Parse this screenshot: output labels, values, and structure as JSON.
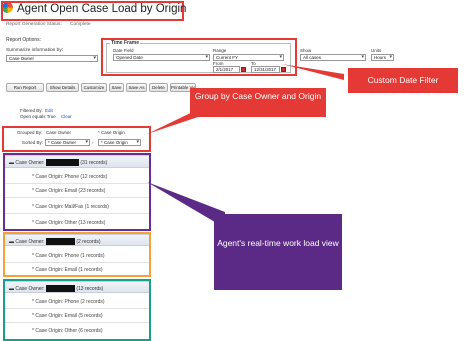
{
  "header": {
    "title": "Agent Open Case Load by Origin",
    "status_label": "Report Generation Status:",
    "status_value": "Complete"
  },
  "options": {
    "heading": "Report Options:",
    "summarize_label": "Summarize information by:",
    "summarize_value": "Case Owner",
    "time_frame_label": "Time Frame",
    "date_field_label": "Date Field",
    "date_field_value": "Opened Date",
    "range_label": "Range",
    "range_value": "Current FY",
    "from_label": "From",
    "from_value": "2/1/2017",
    "to_label": "To",
    "to_value": "12/31/2017",
    "show_label": "Show",
    "show_value": "All cases",
    "units_label": "Units",
    "units_value": "Hours"
  },
  "toolbar": {
    "run_report": "Run Report",
    "hide_details": "Show Details",
    "customize": "Customize",
    "save": "Save",
    "save_as": "Save As",
    "delete": "Delete",
    "printable": "Printable View"
  },
  "filters": {
    "filtered_by": "Filtered By:",
    "edit": "Edit",
    "open_equals": "Open equals True",
    "clear": "Clear"
  },
  "grouping": {
    "grouped_by_label": "Grouped By:",
    "grouped_by_value": "Case Owner",
    "then_label": "* Case Origin",
    "sorted_by_label": "Sorted By:",
    "sorted_by_value": "* Case Owner",
    "sorted_by_value2": "* Case Origin"
  },
  "callouts": {
    "date_filter": "Custom Date Filter",
    "group_by": "Group by Case Owner and Origin",
    "workload": "Agent's real-time work load view"
  },
  "groups": [
    {
      "owner_label": "Case Owner:",
      "owner_count": "(31 records)",
      "rows": [
        "* Case Origin: Phone (12 records)",
        "* Case Origin: Email (23 records)",
        "* Case Origin: Mail/Fax (1 records)",
        "* Case Origin: Other (13 records)"
      ]
    },
    {
      "owner_label": "Case Owner:",
      "owner_count": "(2 records)",
      "rows": [
        "* Case Origin: Phone (1 records)",
        "* Case Origin: Email (1 records)"
      ]
    },
    {
      "owner_label": "Case Owner:",
      "owner_count": "(13 records)",
      "rows": [
        "* Case Origin: Phone (2 records)",
        "* Case Origin: Email (5 records)",
        "* Case Origin: Other (6 records)"
      ]
    }
  ],
  "colors": {
    "annotation_red": "#e53935",
    "annotation_purple": "#5b2a86",
    "annotation_orange": "#f5a13a",
    "annotation_teal": "#1aa08a",
    "link_blue": "#1a5fb4"
  }
}
